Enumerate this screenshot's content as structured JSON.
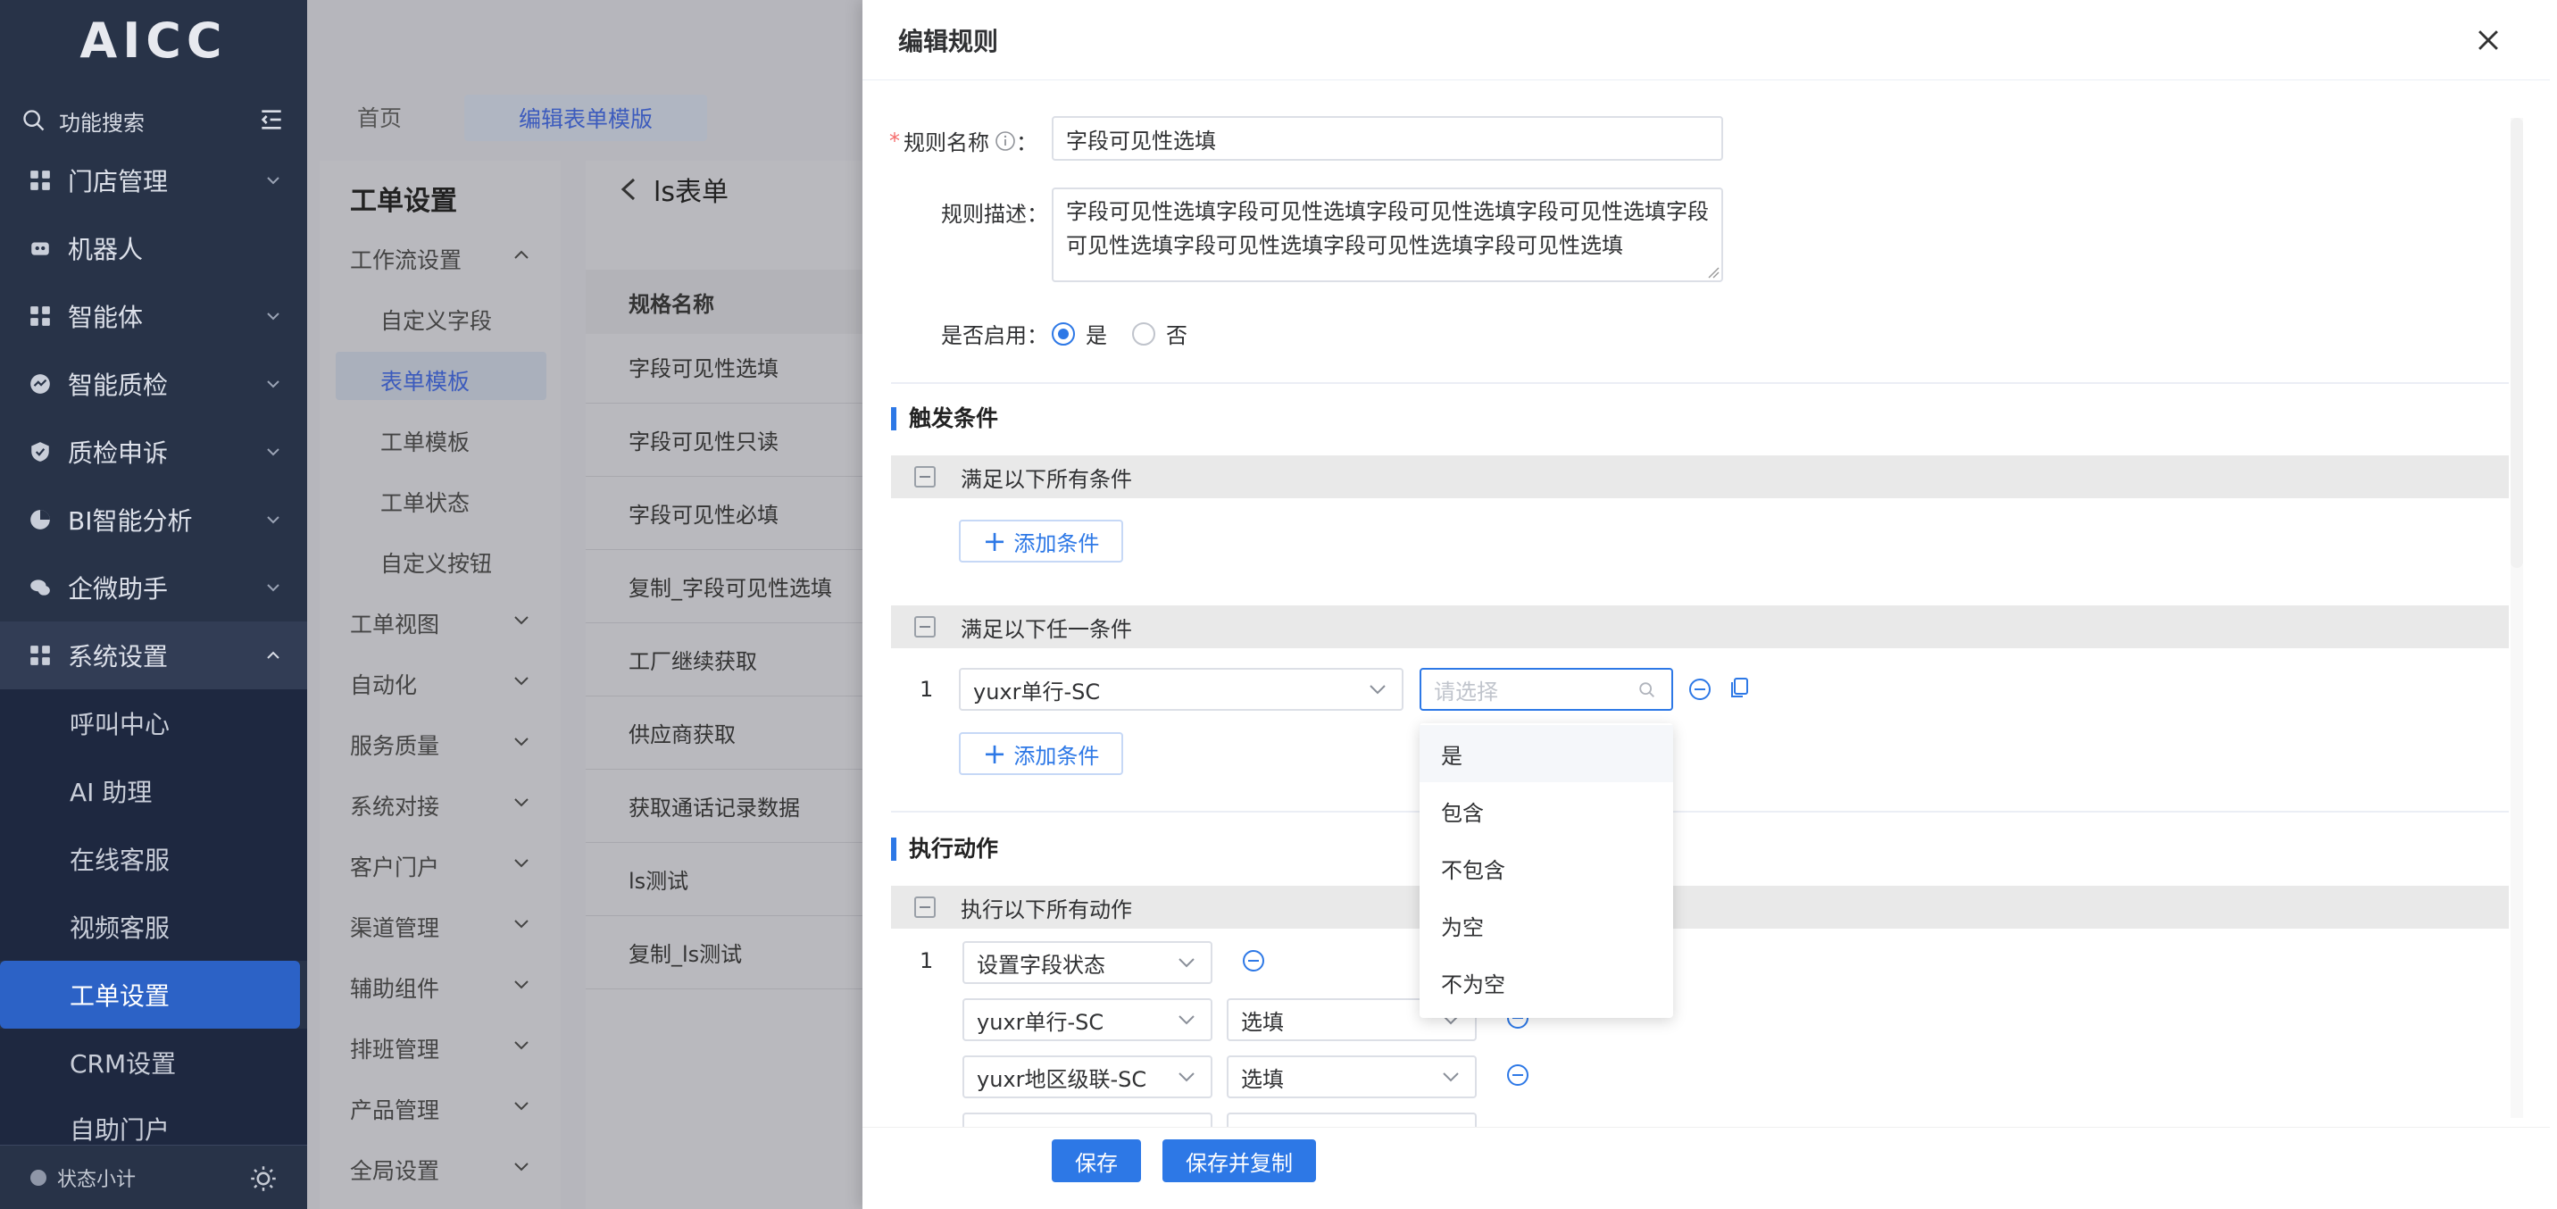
{
  "nav": {
    "logo": "AICC",
    "search_label": "功能搜索",
    "items": [
      {
        "label": "门店管理",
        "icon": "grid-icon"
      },
      {
        "label": "机器人",
        "icon": "robot-icon"
      },
      {
        "label": "智能体",
        "icon": "grid-icon"
      },
      {
        "label": "智能质检",
        "icon": "gauge-icon"
      },
      {
        "label": "质检申诉",
        "icon": "shield-icon"
      },
      {
        "label": "BI智能分析",
        "icon": "pie-icon"
      },
      {
        "label": "企微助手",
        "icon": "chat-icon"
      },
      {
        "label": "系统设置",
        "icon": "grid-icon"
      }
    ],
    "sub_items": [
      "呼叫中心",
      "AI 助理",
      "在线客服",
      "视频客服",
      "工单设置",
      "CRM设置",
      "自助门户"
    ],
    "active_sub": "工单设置",
    "footer_label": "状态小计"
  },
  "tabs": {
    "home": "首页",
    "edit_template": "编辑表单模版"
  },
  "settings_panel": {
    "title": "工单设置",
    "workflow": "工作流设置",
    "sub": [
      "自定义字段",
      "表单模板",
      "工单模板",
      "工单状态",
      "自定义按钮"
    ],
    "groups": [
      "工单视图",
      "自动化",
      "服务质量",
      "系统对接",
      "客户门户",
      "渠道管理",
      "辅助组件",
      "排班管理",
      "产品管理",
      "全局设置"
    ]
  },
  "list_panel": {
    "back_title": "ls表单",
    "col_header": "规格名称",
    "rows": [
      "字段可见性选填",
      "字段可见性只读",
      "字段可见性必填",
      "复制_字段可见性选填",
      "工厂继续获取",
      "供应商获取",
      "获取通话记录数据",
      "ls测试",
      "复制_ls测试"
    ]
  },
  "dialog": {
    "title": "编辑规则",
    "rule_name_label": "规则名称",
    "rule_name_colon": "：",
    "rule_name_value": "字段可见性选填",
    "rule_desc_label": "规则描述：",
    "rule_desc_value": "字段可见性选填字段可见性选填字段可见性选填字段可见性选填字段可见性选填字段可见性选填字段可见性选填字段可见性选填",
    "enabled_label": "是否启用：",
    "enabled_yes": "是",
    "enabled_no": "否",
    "trigger_section": "触发条件",
    "all_conditions": "满足以下所有条件",
    "any_condition": "满足以下任一条件",
    "add_condition": "添加条件",
    "cond_row_num": "1",
    "cond_field": "yuxr单行-SC",
    "cond_op_placeholder": "请选择",
    "dropdown_options": [
      "是",
      "包含",
      "不包含",
      "为空",
      "不为空"
    ],
    "action_section": "执行动作",
    "all_actions": "执行以下所有动作",
    "action_row_num": "1",
    "action_type": "设置字段状态",
    "action_fields": [
      {
        "field": "yuxr单行-SC",
        "state": "选填"
      },
      {
        "field": "yuxr地区级联-SC",
        "state": "选填"
      }
    ],
    "save": "保存",
    "save_copy": "保存并复制"
  },
  "colors": {
    "primary": "#2d78e6",
    "nav_bg": "#283348",
    "nav_active": "#2c62c6"
  }
}
